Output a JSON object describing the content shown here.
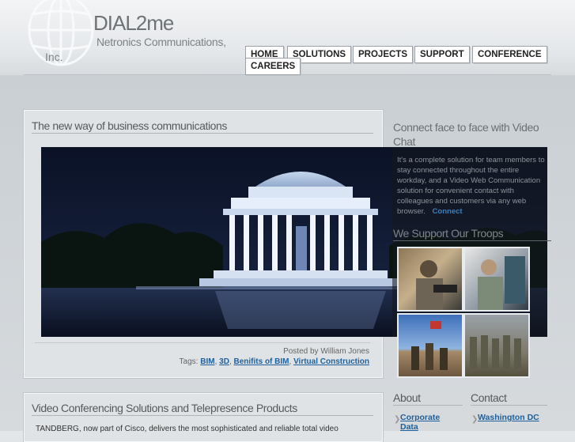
{
  "brand": {
    "title": "DIAL2me",
    "subtitle_line1": "Netronics Communications,",
    "subtitle_line2": "Inc."
  },
  "nav": [
    {
      "label": "HOME"
    },
    {
      "label": "SOLUTIONS"
    },
    {
      "label": "PROJECTS"
    },
    {
      "label": "SUPPORT"
    },
    {
      "label": "CONFERENCE"
    },
    {
      "label": "CAREERS"
    }
  ],
  "main_post": {
    "title": "The new way of business communications",
    "posted_by": "Posted by William Jones",
    "tags_label": "Tags:",
    "tags": [
      "BIM",
      "3D",
      "Benifits of BIM",
      "Virtual Construction"
    ]
  },
  "sidebar": {
    "video_title": "Connect face to face with Video Chat",
    "video_text": "It's a complete solution for team members to stay connected throughout the entire workday, and a Video Web Communication solution for convenient contact with colleagues and customers via any web browser.",
    "video_link": "Connect",
    "troops_title": "We Support Our Troops"
  },
  "second_post": {
    "title": "Video Conferencing Solutions and Telepresence Products",
    "text": "TANDBERG, now part of Cisco, delivers the most sophisticated and reliable total video"
  },
  "about": {
    "title": "About",
    "items": [
      "Corporate Data"
    ]
  },
  "contact": {
    "title": "Contact",
    "items": [
      "Washington DC"
    ]
  },
  "colors": {
    "link": "#1f5f9a",
    "nav_border": "#9ba1a6",
    "panel": "#dfe3e6"
  }
}
